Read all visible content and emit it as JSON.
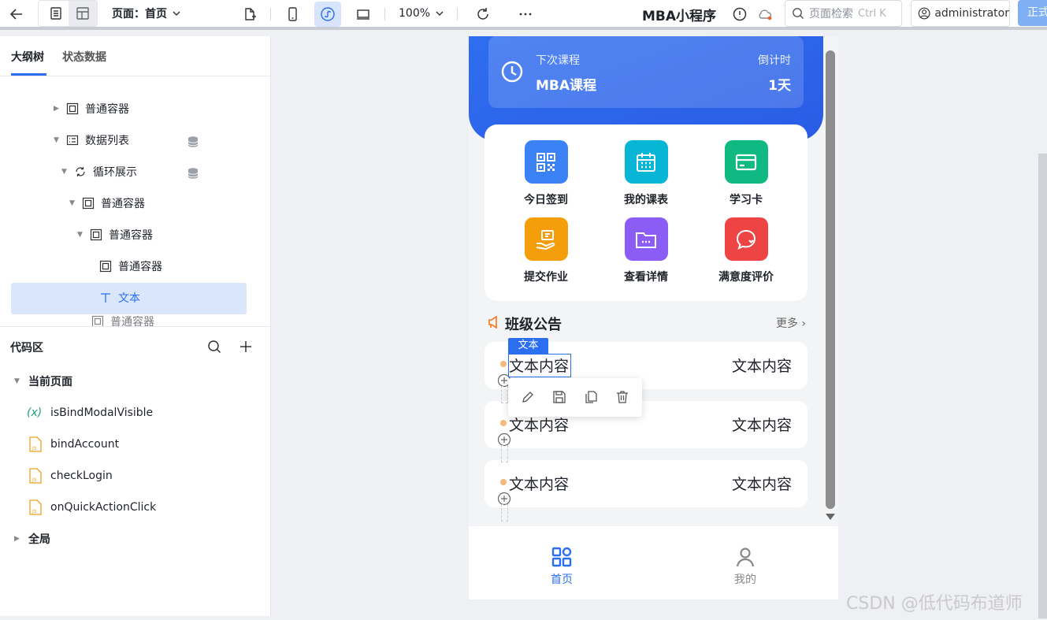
{
  "toolbar": {
    "page_label": "页面：首页",
    "zoom": "100%",
    "app_title": "MBA小程序",
    "search_placeholder": "页面检索",
    "search_shortcut": "Ctrl K",
    "user": "administrator",
    "publish_label": "正式"
  },
  "left_panel": {
    "tabs": [
      {
        "label": "大纲树"
      },
      {
        "label": "状态数据"
      }
    ],
    "tree": [
      {
        "label": "普通容器",
        "icon": "container-icon"
      },
      {
        "label": "数据列表",
        "icon": "list-icon"
      },
      {
        "label": "循环展示",
        "icon": "loop-icon"
      },
      {
        "label": "普通容器",
        "icon": "container-icon"
      },
      {
        "label": "普通容器",
        "icon": "container-icon"
      },
      {
        "label": "普通容器",
        "icon": "container-icon"
      },
      {
        "label": "文本",
        "icon": "text-icon"
      },
      {
        "label": "普通容器",
        "icon": "container-icon"
      }
    ],
    "code_area": {
      "title": "代码区",
      "current_page": "当前页面",
      "items": [
        {
          "label": "isBindModalVisible",
          "icon": "variable-icon"
        },
        {
          "label": "bindAccount",
          "icon": "js-file-icon"
        },
        {
          "label": "checkLogin",
          "icon": "js-file-icon"
        },
        {
          "label": "onQuickActionClick",
          "icon": "js-file-icon"
        }
      ],
      "global": "全局"
    }
  },
  "phone": {
    "next_course": {
      "label": "下次课程",
      "course": "MBA课程",
      "countdown_label": "倒计时",
      "countdown_value": "1天"
    },
    "actions": [
      {
        "label": "今日签到",
        "icon": "qrcode-icon",
        "color": "#3b82f6"
      },
      {
        "label": "我的课表",
        "icon": "calendar-icon",
        "color": "#06b6d4"
      },
      {
        "label": "学习卡",
        "icon": "card-icon",
        "color": "#10b981"
      },
      {
        "label": "提交作业",
        "icon": "hand-upload-icon",
        "color": "#f59e0b"
      },
      {
        "label": "查看详情",
        "icon": "folder-icon",
        "color": "#8b5cf6"
      },
      {
        "label": "满意度评价",
        "icon": "chat-heart-icon",
        "color": "#ef4444"
      }
    ],
    "notice": {
      "title": "班级公告",
      "more": "更多",
      "items": [
        {
          "left": "文本内容",
          "right": "文本内容"
        },
        {
          "left": "文本内容",
          "right": "文本内容"
        },
        {
          "left": "文本内容",
          "right": "文本内容"
        }
      ]
    },
    "selection_badge": "文本",
    "tabbar": [
      {
        "label": "首页",
        "active": true
      },
      {
        "label": "我的",
        "active": false
      }
    ]
  },
  "watermark": "CSDN @低代码布道师"
}
